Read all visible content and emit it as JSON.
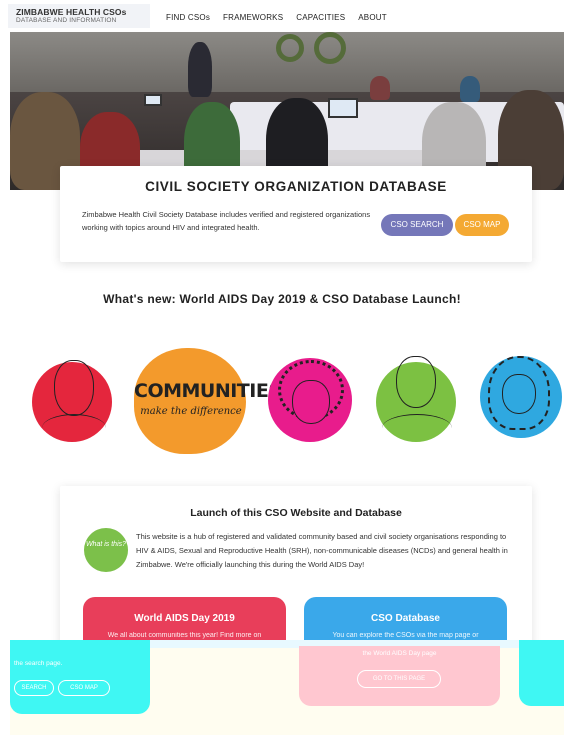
{
  "header": {
    "brand_title": "ZIMBABWE HEALTH CSOs",
    "brand_subtitle": "DATABASE AND INFORMATION",
    "nav": [
      "FIND CSOs",
      "FRAMEWORKS",
      "CAPACITIES",
      "ABOUT"
    ]
  },
  "db_card": {
    "title": "CIVIL SOCIETY ORGANIZATION DATABASE",
    "description": "Zimbabwe Health Civil Society Database includes verified and registered organizations working with topics around HIV and integrated health.",
    "search_button": "CSO SEARCH",
    "map_button": "CSO MAP"
  },
  "whats_new": "What's new: World AIDS Day 2019 & CSO Database Launch!",
  "communities_graphic": {
    "line1": "COMMUNITIES",
    "line2": "make the difference"
  },
  "launch": {
    "title": "Launch of this CSO Website and Database",
    "badge": "What is this?",
    "text": "This website is a hub of registered and validated community based and civil society organisations responding to HIV & AIDS, Sexual and Reproductive Health (SRH), non-communicable diseases (NCDs) and general health in Zimbabwe. We're officially launching this during the World AIDS Day!",
    "tiles": [
      {
        "title": "World AIDS Day 2019",
        "subtitle": "We all about communities this year! Find more on"
      },
      {
        "title": "CSO Database",
        "subtitle": "You can explore the CSOs via the map page or"
      }
    ]
  },
  "glitch": {
    "left_text": "the search page.",
    "left_buttons": [
      "SEARCH",
      "CSO MAP"
    ],
    "mid_text": "the World AIDS Day page",
    "mid_button": "GO TO THIS PAGE"
  },
  "colors": {
    "search": "#7577b9",
    "map": "#f4a933",
    "red_tile": "#e83e5a",
    "blue_tile": "#3aa8ea",
    "badge": "#7cc04a"
  }
}
